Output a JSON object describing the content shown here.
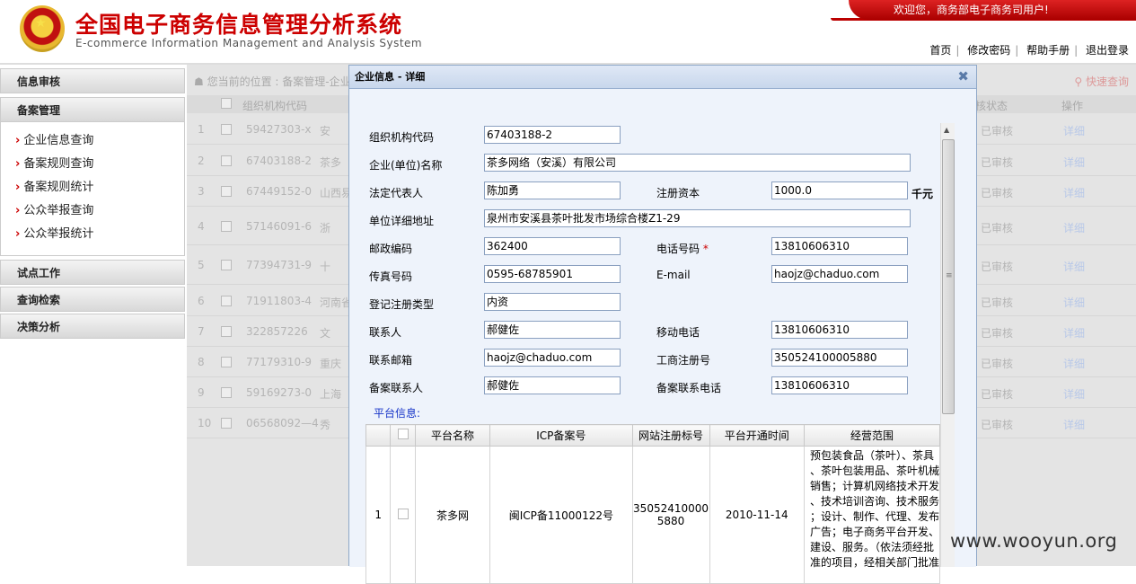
{
  "header": {
    "welcome": "欢迎您，商务部电子商务司用户!",
    "title_cn": "全国电子商务信息管理分析系统",
    "title_en": "E-commerce Information Management and Analysis System",
    "nav": [
      "首页",
      "修改密码",
      "帮助手册",
      "退出登录"
    ]
  },
  "sidebar": {
    "sections": [
      {
        "label": "信息审核"
      },
      {
        "label": "备案管理",
        "items": [
          "企业信息查询",
          "备案规则查询",
          "备案规则统计",
          "公众举报查询",
          "公众举报统计"
        ]
      },
      {
        "label": "试点工作"
      },
      {
        "label": "查询检索"
      },
      {
        "label": "决策分析"
      }
    ]
  },
  "background": {
    "crumb": "您当前的位置 : 备案管理-企业",
    "quick": "快速查询",
    "headers": {
      "org": "组织机构代码",
      "status": "核状态",
      "op": "操作"
    },
    "rows": [
      {
        "no": "1",
        "code": "59427303-x",
        "area": "安",
        "status": "已审核",
        "op": "详细"
      },
      {
        "no": "2",
        "code": "67403188-2",
        "area": "茶多",
        "status": "已审核",
        "op": "详细"
      },
      {
        "no": "3",
        "code": "67449152-0",
        "area": "山西易",
        "status": "已审核",
        "op": "详细"
      },
      {
        "no": "4",
        "code": "57146091-6",
        "area": "浙",
        "status": "已审核",
        "op": "详细"
      },
      {
        "no": "5",
        "code": "77394731-9",
        "area": "十",
        "status": "已审核",
        "op": "详细"
      },
      {
        "no": "6",
        "code": "71911803-4",
        "area": "河南省",
        "status": "已审核",
        "op": "详细"
      },
      {
        "no": "7",
        "code": "322857226",
        "area": "文",
        "status": "已审核",
        "op": "详细"
      },
      {
        "no": "8",
        "code": "77179310-9",
        "area": "重庆",
        "status": "已审核",
        "op": "详细"
      },
      {
        "no": "9",
        "code": "59169273-0",
        "area": "上海",
        "status": "已审核",
        "op": "详细"
      },
      {
        "no": "10",
        "code": "06568092—4",
        "area": "秀",
        "status": "已审核",
        "op": "详细"
      }
    ]
  },
  "dialog": {
    "title": "企业信息 - 详细",
    "fields": {
      "org_code": {
        "label": "组织机构代码",
        "value": "67403188-2"
      },
      "company": {
        "label": "企业(单位)名称",
        "value": "茶多网络（安溪）有限公司"
      },
      "legal": {
        "label": "法定代表人",
        "value": "陈加勇"
      },
      "capital": {
        "label": "注册资本",
        "value": "1000.0",
        "unit": "千元"
      },
      "address": {
        "label": "单位详细地址",
        "value": "泉州市安溪县茶叶批发市场综合楼Z1-29"
      },
      "postcode": {
        "label": "邮政编码",
        "value": "362400"
      },
      "phone": {
        "label": "电话号码",
        "value": "13810606310"
      },
      "fax": {
        "label": "传真号码",
        "value": "0595-68785901"
      },
      "email": {
        "label": "E-mail",
        "value": "haojz@chaduo.com"
      },
      "reg_type": {
        "label": "登记注册类型",
        "value": "内资"
      },
      "contact": {
        "label": "联系人",
        "value": "郝健佐"
      },
      "mobile": {
        "label": "移动电话",
        "value": "13810606310"
      },
      "contact_email": {
        "label": "联系邮箱",
        "value": "haojz@chaduo.com"
      },
      "biz_reg": {
        "label": "工商注册号",
        "value": "350524100005880"
      },
      "filing_contact": {
        "label": "备案联系人",
        "value": "郝健佐"
      },
      "filing_phone": {
        "label": "备案联系电话",
        "value": "13810606310"
      }
    },
    "platform": {
      "title": "平台信息:",
      "headers": [
        "平台名称",
        "ICP备案号",
        "网站注册标号",
        "平台开通时间",
        "经营范围"
      ],
      "row": {
        "no": "1",
        "name": "茶多网",
        "icp": "闽ICP备11000122号",
        "reg_no_1": "35052410000",
        "reg_no_2": "5880",
        "open_date": "2010-11-14",
        "scope": [
          "预包装食品（茶叶）、茶具",
          "、茶叶包装用品、茶叶机械",
          "销售；计算机网络技术开发",
          "、技术培训咨询、技术服务",
          "；设计、制作、代理、发布",
          "广告；电子商务平台开发、",
          "建设、服务。（依法须经批",
          "准的项目，经相关部门批准"
        ]
      }
    }
  },
  "watermark": "www.wooyun.org"
}
